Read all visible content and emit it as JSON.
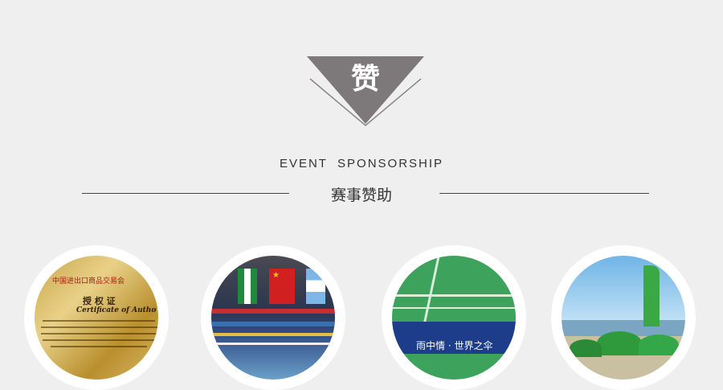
{
  "header": {
    "emblem_char": "赞",
    "title_en": "EVENT  SPONSORSHIP",
    "title_cn": "赛事赞助"
  },
  "colors": {
    "background": "#efefef",
    "emblem_gray": "#7d7879",
    "text": "#333333"
  },
  "thumbnails": [
    {
      "name": "certificate",
      "heading": "中国进出口商品交易会",
      "title_cn": "授 权 证",
      "title_en": "Certificate of Autho"
    },
    {
      "name": "stadium-flags"
    },
    {
      "name": "badminton-court",
      "banner": "雨中情 · 世界之伞"
    },
    {
      "name": "beach-umbrellas"
    }
  ]
}
